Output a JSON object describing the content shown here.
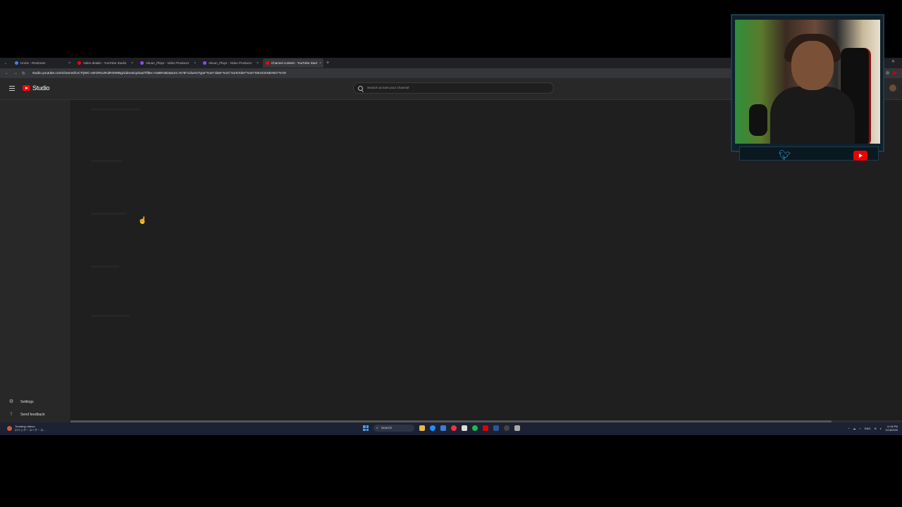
{
  "browser": {
    "tabs": [
      {
        "label": "Home - Restream",
        "color": "#3b82f6",
        "active": false
      },
      {
        "label": "Video details - YouTube Studio",
        "color": "#ff0000",
        "active": false
      },
      {
        "label": "Akuun_Plays - Video Producer",
        "color": "#9147ff",
        "active": false
      },
      {
        "label": "Akuun_Plays - Video Producer",
        "color": "#9147ff",
        "active": false
      },
      {
        "label": "Channel content - YouTube Studio",
        "color": "#ff0000",
        "active": true
      }
    ],
    "new_tab": "+",
    "url": "studio.youtube.com/channel/UCTrjWC-v6rORUZKdRzNRBg/videos/upload?filter=%5B%5D&sort=%7B\"columnType\"%3A\"date\"%2C\"sortOrder\"%3A\"DESCENDING\"%7D"
  },
  "header": {
    "logo_text": "Studio",
    "search_placeholder": "Search across your channel"
  },
  "sidebar": {
    "settings_label": "Settings",
    "feedback_label": "Send feedback"
  },
  "taskbar": {
    "notification_line1": "Trending videos",
    "notification_line2": "ロイック・コーク・コ…",
    "search_label": "Search",
    "lang": "ENG",
    "time": "11:06 PM",
    "date": "11/18/2025"
  }
}
